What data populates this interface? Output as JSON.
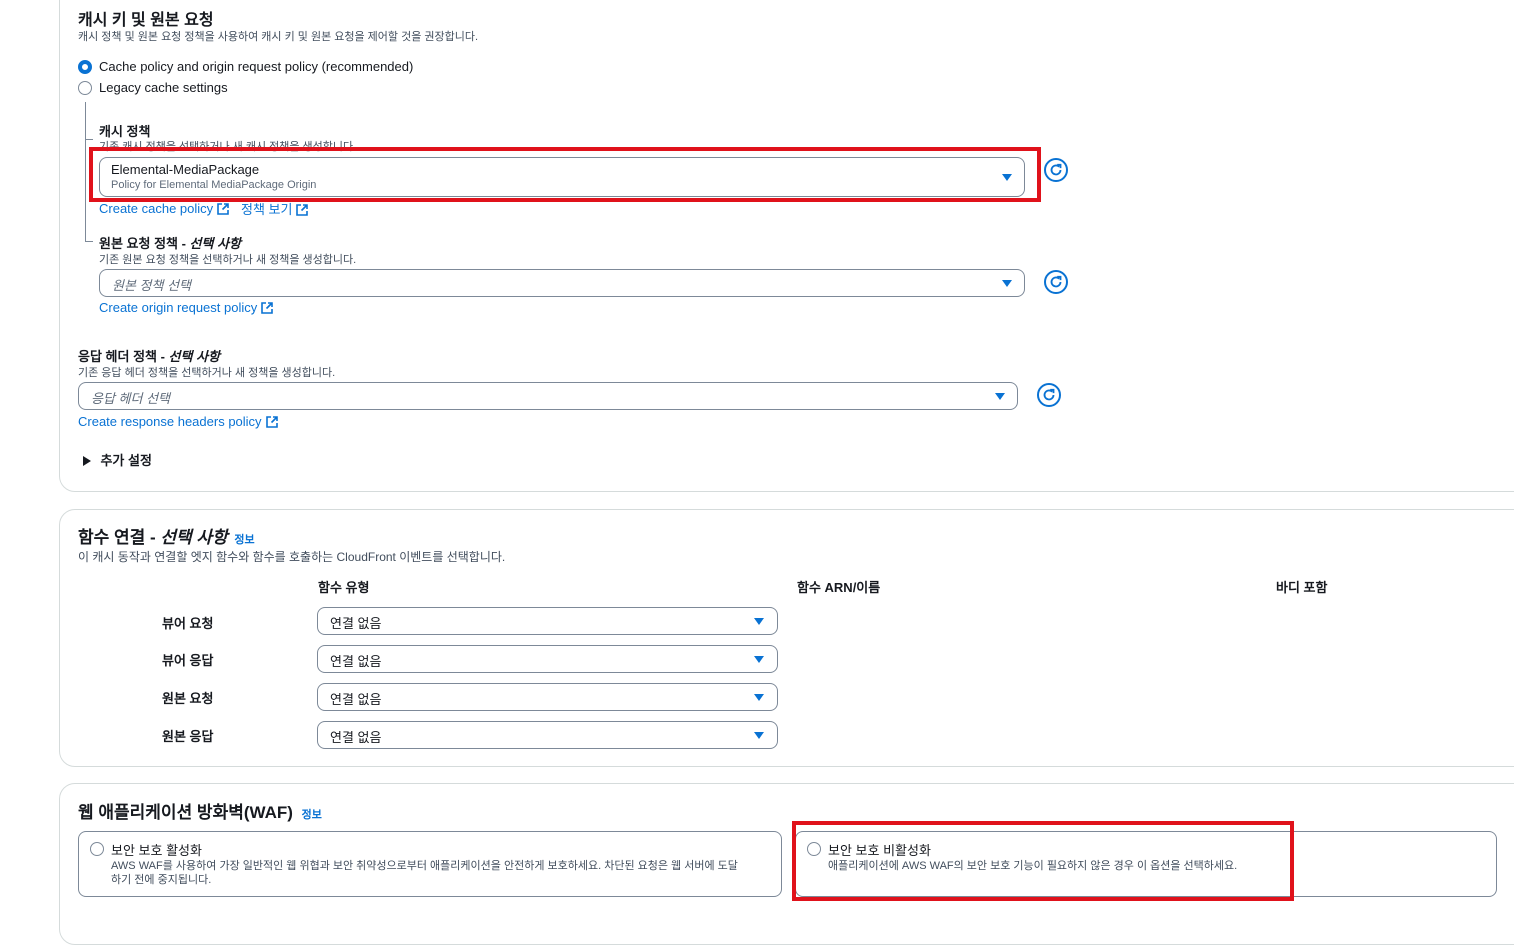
{
  "cache_section": {
    "title": "캐시 키 및 원본 요청",
    "description": "캐시 정책 및 원본 요청 정책을 사용하여 캐시 키 및 원본 요청을 제어할 것을 권장합니다.",
    "options": [
      {
        "label": "Cache policy and origin request policy (recommended)",
        "selected": true
      },
      {
        "label": "Legacy cache settings",
        "selected": false
      }
    ],
    "cache_policy": {
      "label": "캐시 정책",
      "description": "기존 캐시 정책을 선택하거나 새 캐시 정책을 생성합니다.",
      "selected_value": "Elemental-MediaPackage",
      "selected_description": "Policy for Elemental MediaPackage Origin",
      "create_link": "Create cache policy",
      "view_link": "정책 보기"
    },
    "origin_request_policy": {
      "label": "원본 요청 정책 - ",
      "label_optional": "선택 사항",
      "description": "기존 원본 요청 정책을 선택하거나 새 정책을 생성합니다.",
      "placeholder": "원본 정책 선택",
      "create_link": "Create origin request policy"
    },
    "response_headers_policy": {
      "label": "응답 헤더 정책 - ",
      "label_optional": "선택 사항",
      "description": "기존 응답 헤더 정책을 선택하거나 새 정책을 생성합니다.",
      "placeholder": "응답 헤더 선택",
      "create_link": "Create response headers policy"
    },
    "additional_settings": "추가 설정"
  },
  "function_section": {
    "title": "함수 연결 - ",
    "title_optional": "선택 사항",
    "info": "정보",
    "description": "이 캐시 동작과 연결할 엣지 함수와 함수를 호출하는 CloudFront 이벤트를 선택합니다.",
    "columns": [
      "함수 유형",
      "함수 ARN/이름",
      "바디 포함"
    ],
    "rows": [
      {
        "event": "뷰어 요청",
        "value": "연결 없음"
      },
      {
        "event": "뷰어 응답",
        "value": "연결 없음"
      },
      {
        "event": "원본 요청",
        "value": "연결 없음"
      },
      {
        "event": "원본 응답",
        "value": "연결 없음"
      }
    ]
  },
  "waf_section": {
    "title": "웹 애플리케이션 방화벽(WAF)",
    "info": "정보",
    "options": [
      {
        "label": "보안 보호 활성화",
        "description_line1": "AWS WAF를 사용하여 가장 일반적인 웹 위협과 보안 취약성으로부터 애플리케이션을 안전하게 보호하세요. 차단된 요청은 웹 서버에 도달",
        "description_line2": "하기 전에 중지됩니다.",
        "selected": false
      },
      {
        "label": "보안 보호 비활성화",
        "description_line1": "애플리케이션에 AWS WAF의 보안 보호 기능이 필요하지 않은 경우 이 옵션을 선택하세요.",
        "selected": false
      }
    ]
  },
  "colors": {
    "accent": "#0972d3",
    "highlight": "#e0121b",
    "border": "#7d8998",
    "text": "#16191f"
  }
}
